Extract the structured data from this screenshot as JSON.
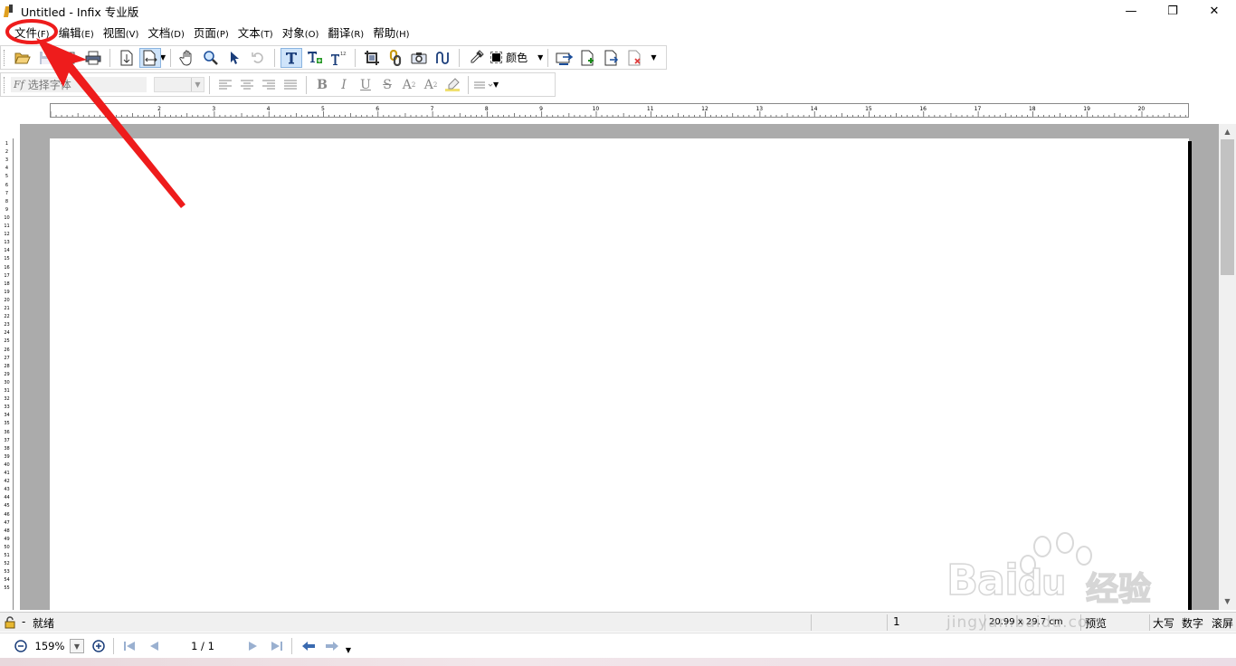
{
  "window": {
    "title": "Untitled - Infix 专业版",
    "minimize_glyph": "—",
    "maximize_glyph": "❐",
    "close_glyph": "✕"
  },
  "menubar": {
    "items": [
      {
        "label": "文件",
        "accel": "(F)"
      },
      {
        "label": "编辑",
        "accel": "(E)"
      },
      {
        "label": "视图",
        "accel": "(V)"
      },
      {
        "label": "文档",
        "accel": "(D)"
      },
      {
        "label": "页面",
        "accel": "(P)"
      },
      {
        "label": "文本",
        "accel": "(T)"
      },
      {
        "label": "对象",
        "accel": "(O)"
      },
      {
        "label": "翻译",
        "accel": "(R)"
      },
      {
        "label": "帮助",
        "accel": "(H)"
      }
    ]
  },
  "toolbar_main": {
    "icons": [
      "open-folder-icon",
      "save-icon",
      "print-preview-icon",
      "print-icon",
      "page-fit-icon",
      "page-width-icon",
      "hand-tool-icon",
      "zoom-icon",
      "select-arrow-icon",
      "rotate-icon",
      "text-tool-icon",
      "text-edit-icon",
      "text-number-icon",
      "crop-icon",
      "link-icon",
      "camera-icon",
      "eraser-icon",
      "eyedropper-icon",
      "replace-page-icon",
      "insert-page-icon",
      "extract-page-icon",
      "delete-page-icon"
    ],
    "color_label": "颜色",
    "color_value": "#000000"
  },
  "toolbar_format": {
    "font_placeholder": "选择字体",
    "font_glyph": "Ff",
    "bold": "B",
    "italic": "I",
    "underline": "U",
    "strike": "S",
    "superscript": "A",
    "subscript": "A"
  },
  "hruler": {
    "labels": [
      "2",
      "3",
      "4",
      "5",
      "6",
      "7",
      "8",
      "9",
      "10",
      "11",
      "12",
      "13",
      "14",
      "15",
      "16",
      "17",
      "18",
      "19",
      "20"
    ]
  },
  "vruler": {
    "labels": [
      "1",
      "2",
      "3",
      "4",
      "5",
      "6",
      "7",
      "8",
      "9",
      "10",
      "11",
      "12",
      "13",
      "14",
      "15",
      "16",
      "17",
      "18",
      "19",
      "20",
      "21",
      "22",
      "23",
      "24",
      "25",
      "26",
      "27",
      "28",
      "29",
      "30",
      "31",
      "32",
      "33",
      "34",
      "35",
      "36",
      "37",
      "38",
      "39",
      "40",
      "41",
      "42",
      "43",
      "44",
      "45",
      "46",
      "47",
      "48",
      "49",
      "50",
      "51",
      "52",
      "53",
      "54",
      "55"
    ]
  },
  "statusbar": {
    "lock_dash": "-",
    "status": "就绪",
    "page_number": "1",
    "dimensions": "20.99 x 29.7 cm",
    "mode": "预览",
    "caps": "大写",
    "num": "数字",
    "scroll": "滚屏"
  },
  "navbar": {
    "zoom": "159%",
    "page": "1 / 1"
  },
  "watermark": {
    "brand": "Bai",
    "brand2": "du",
    "cn": "经验",
    "url": "jingyan.baidu.com"
  },
  "colors": {
    "accent_annotation": "#ee1c1c",
    "doc_background": "#ababab",
    "active_button": "#cfe4fa"
  }
}
